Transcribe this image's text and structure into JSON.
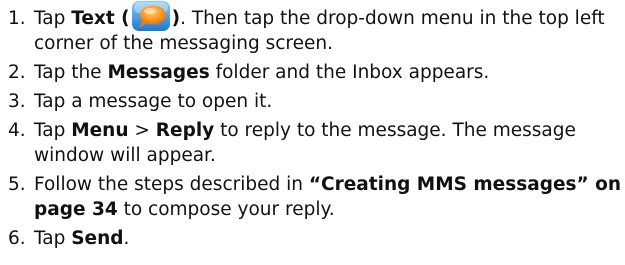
{
  "steps": [
    {
      "num": "1.",
      "prefix": "Tap ",
      "bold1": "Text (",
      "icon": "text-messaging-icon",
      "bold2": ")",
      "rest": ". Then tap the drop-down menu in the top left corner of the messaging screen."
    },
    {
      "num": "2.",
      "prefix": "Tap the ",
      "bold": "Messages",
      "rest": " folder and the Inbox appears."
    },
    {
      "num": "3.",
      "text": "Tap a message to open it."
    },
    {
      "num": "4.",
      "prefix": "Tap ",
      "bold1": "Menu",
      "sep": " > ",
      "bold2": "Reply",
      "rest": " to reply to the message. The message window will appear."
    },
    {
      "num": "5.",
      "prefix": "Follow the steps described in ",
      "bold": "“Creating MMS messages” on page 34",
      "rest": " to compose your reply."
    },
    {
      "num": "6.",
      "prefix": "Tap ",
      "bold": "Send",
      "rest": "."
    }
  ],
  "colors": {
    "icon_bg_top": "#7fc3f3",
    "icon_bg_bottom": "#1f7fd6",
    "bubble_orange": "#f7941d"
  }
}
